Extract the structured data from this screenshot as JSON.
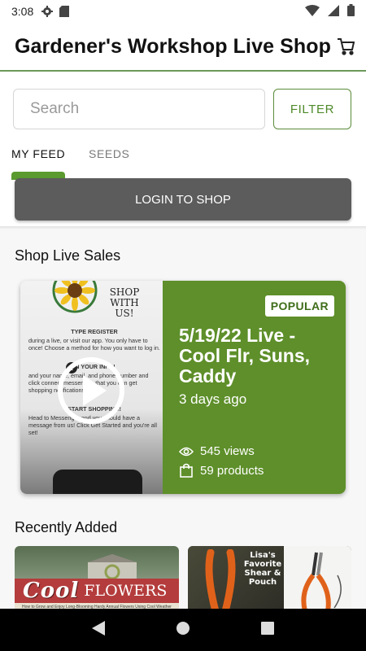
{
  "status_bar": {
    "time": "3:08",
    "icons": [
      "settings-gear-icon",
      "sd-card-icon",
      "wifi-icon",
      "signal-icon",
      "battery-icon"
    ]
  },
  "app_bar": {
    "title": "Gardener's Workshop Live Shop",
    "cart_icon": "cart-icon"
  },
  "search": {
    "placeholder": "Search",
    "filter_label": "FILTER"
  },
  "tabs": [
    {
      "label": "MY FEED",
      "active": true
    },
    {
      "label": "SEEDS",
      "active": false
    }
  ],
  "login_button": "LOGIN TO SHOP",
  "live_sales": {
    "section_title": "Shop Live Sales",
    "card": {
      "badge": "POPULAR",
      "title": "5/19/22 Live - Cool Flr, Suns, Caddy",
      "time_ago": "3 days ago",
      "views": "545 views",
      "products": "59 products",
      "thumbnail": {
        "heading": "SHOP WITH US!",
        "step1_title": "TYPE REGISTER",
        "step1_text": "during a live, or visit our app. You only have to once! Choose a method for how you want to log in.",
        "step2_title": "IN YOUR INFO!",
        "step2_text": "and your name, email, and phone number and click connect messenger, that you can get shopping notifications.",
        "step3_title": "START SHOPPING!",
        "step3_text": "Head to Messenger and you should have a message from us! Click Get Started and you're all set!"
      }
    }
  },
  "recently_added": {
    "section_title": "Recently Added",
    "items": [
      {
        "title_big": "Cool",
        "title_small": "FLOWERS",
        "subtitle": "How to Grow and Enjoy Long-Blooming Hardy Annual Flowers Using Cool Weather Techniques"
      },
      {
        "title": "Lisa's Favorite Shear & Pouch"
      }
    ]
  },
  "nav_bar": [
    "back-icon",
    "home-icon",
    "recents-icon"
  ],
  "colors": {
    "brand_green": "#5e8f2a",
    "login_gray": "#5c5c5c"
  }
}
